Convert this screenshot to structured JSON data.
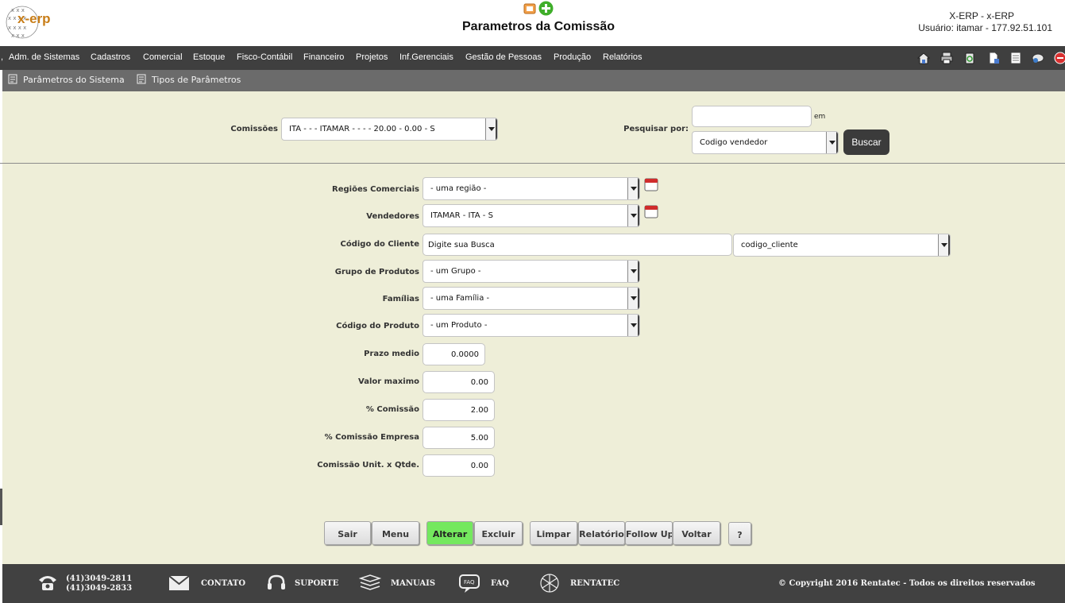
{
  "header": {
    "logo_text": "x-erp",
    "title": "Parametros da Comissão",
    "system_line": "X-ERP - x-ERP",
    "user_line": "Usuário: itamar - 177.92.51.101",
    "icons": [
      "report-icon",
      "add-icon"
    ]
  },
  "menu": {
    "items": [
      "Adm. de Sistemas",
      "Cadastros",
      "Comercial",
      "Estoque",
      "Fisco-Contábil",
      "Financeiro",
      "Projetos",
      "Inf.Gerenciais",
      "Gestão de Pessoas",
      "Produção",
      "Relatórios"
    ],
    "tool_icons": [
      "home-icon",
      "print-icon",
      "recycle-icon",
      "document-icon",
      "note-icon",
      "database-icon",
      "exit-icon"
    ]
  },
  "submenu": {
    "items": [
      "Parâmetros do Sistema",
      "Tipos de Parâmetros"
    ]
  },
  "search": {
    "commissions_label": "Comissões",
    "commissions_value": "ITA - - - ITAMAR - - - - 20.00 - 0.00 - S",
    "search_by_label": "Pesquisar por:",
    "search_value": "",
    "em_label": "em",
    "field_value": "Codigo vendedor",
    "button_label": "Buscar"
  },
  "form": {
    "regioes_label": "Regiões Comerciais",
    "regioes_value": "- uma região -",
    "vendedores_label": "Vendedores",
    "vendedores_value": "ITAMAR - ITA - S",
    "cliente_label": "Código do Cliente",
    "cliente_value": "Digite sua Busca",
    "cliente_field_value": "codigo_cliente",
    "grupo_label": "Grupo de Produtos",
    "grupo_value": "- um Grupo -",
    "familias_label": "Famílias",
    "familias_value": "- uma Família -",
    "produto_label": "Código do Produto",
    "produto_value": "- um Produto -",
    "prazo_label": "Prazo medio",
    "prazo_value": "0.0000",
    "valor_label": "Valor maximo",
    "valor_value": "0.00",
    "comissao_label": "% Comissão",
    "comissao_value": "2.00",
    "comissao_empresa_label": "% Comissão Empresa",
    "comissao_empresa_value": "5.00",
    "comissao_unit_label": "Comissão Unit. x Qtde.",
    "comissao_unit_value": "0.00"
  },
  "buttons": {
    "sair": "Sair",
    "menu": "Menu",
    "alterar": "Alterar",
    "excluir": "Excluir",
    "limpar": "Limpar",
    "relatorio": "Relatório",
    "follow_up": "Follow Up",
    "voltar": "Voltar",
    "help": "?"
  },
  "footer": {
    "phone1": "(41)3049-2811",
    "phone2": "(41)3049-2833",
    "contato": "CONTATO",
    "suporte": "SUPORTE",
    "manuais": "MANUAIS",
    "faq": "FAQ",
    "rentatec": "RENTATEC",
    "copyright": "© Copyright 2016 Rentatec - Todos os direitos reservados"
  },
  "colors": {
    "content_bg": "#eeeed8",
    "menubar_bg": "#3f3f3f",
    "active_button": "#74e85e"
  }
}
